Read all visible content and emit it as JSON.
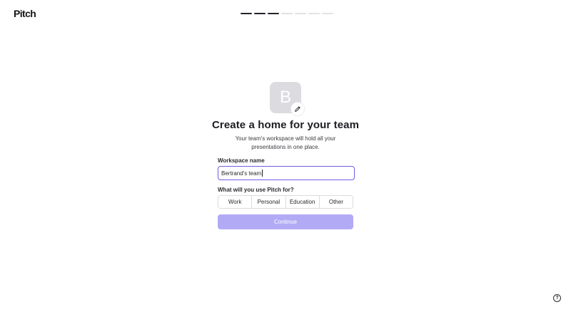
{
  "brand": {
    "logo_text": "Pitch"
  },
  "progress": {
    "total_steps": 7,
    "completed_steps": 3
  },
  "avatar": {
    "initial": "B",
    "edit_icon": "pencil-icon"
  },
  "heading": {
    "title": "Create a home for your team",
    "subtitle": "Your team's workspace will hold all your presentations in one place."
  },
  "workspace": {
    "label": "Workspace name",
    "value": "Bertrand's team"
  },
  "usage": {
    "label": "What will you use Pitch for?",
    "options": [
      "Work",
      "Personal",
      "Education",
      "Other"
    ]
  },
  "actions": {
    "continue_label": "Continue"
  },
  "help": {
    "icon": "help-icon",
    "glyph": "?"
  },
  "colors": {
    "accent": "#6f5de8",
    "button_disabled": "#b3aaf6",
    "progress_done": "#23232b",
    "progress_todo": "#e2e2e6",
    "avatar_bg": "#dcdce0"
  }
}
